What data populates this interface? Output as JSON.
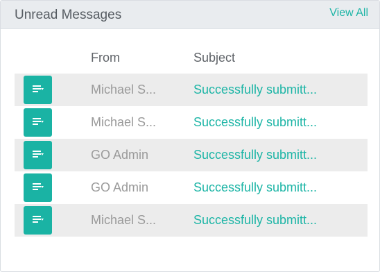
{
  "header": {
    "title": "Unread Messages",
    "view_all": "View All"
  },
  "columns": {
    "from": "From",
    "subject": "Subject"
  },
  "messages": [
    {
      "from": "Michael S...",
      "subject": "Successfully submitt..."
    },
    {
      "from": "Michael S...",
      "subject": "Successfully submitt..."
    },
    {
      "from": "GO Admin",
      "subject": "Successfully submitt..."
    },
    {
      "from": "GO Admin",
      "subject": "Successfully submitt..."
    },
    {
      "from": "Michael S...",
      "subject": "Successfully submitt..."
    }
  ],
  "icons": {
    "row_button": "message-icon"
  },
  "colors": {
    "accent": "#1ab3a4",
    "header_bg": "#e9ecef",
    "row_shade": "#ececec"
  }
}
